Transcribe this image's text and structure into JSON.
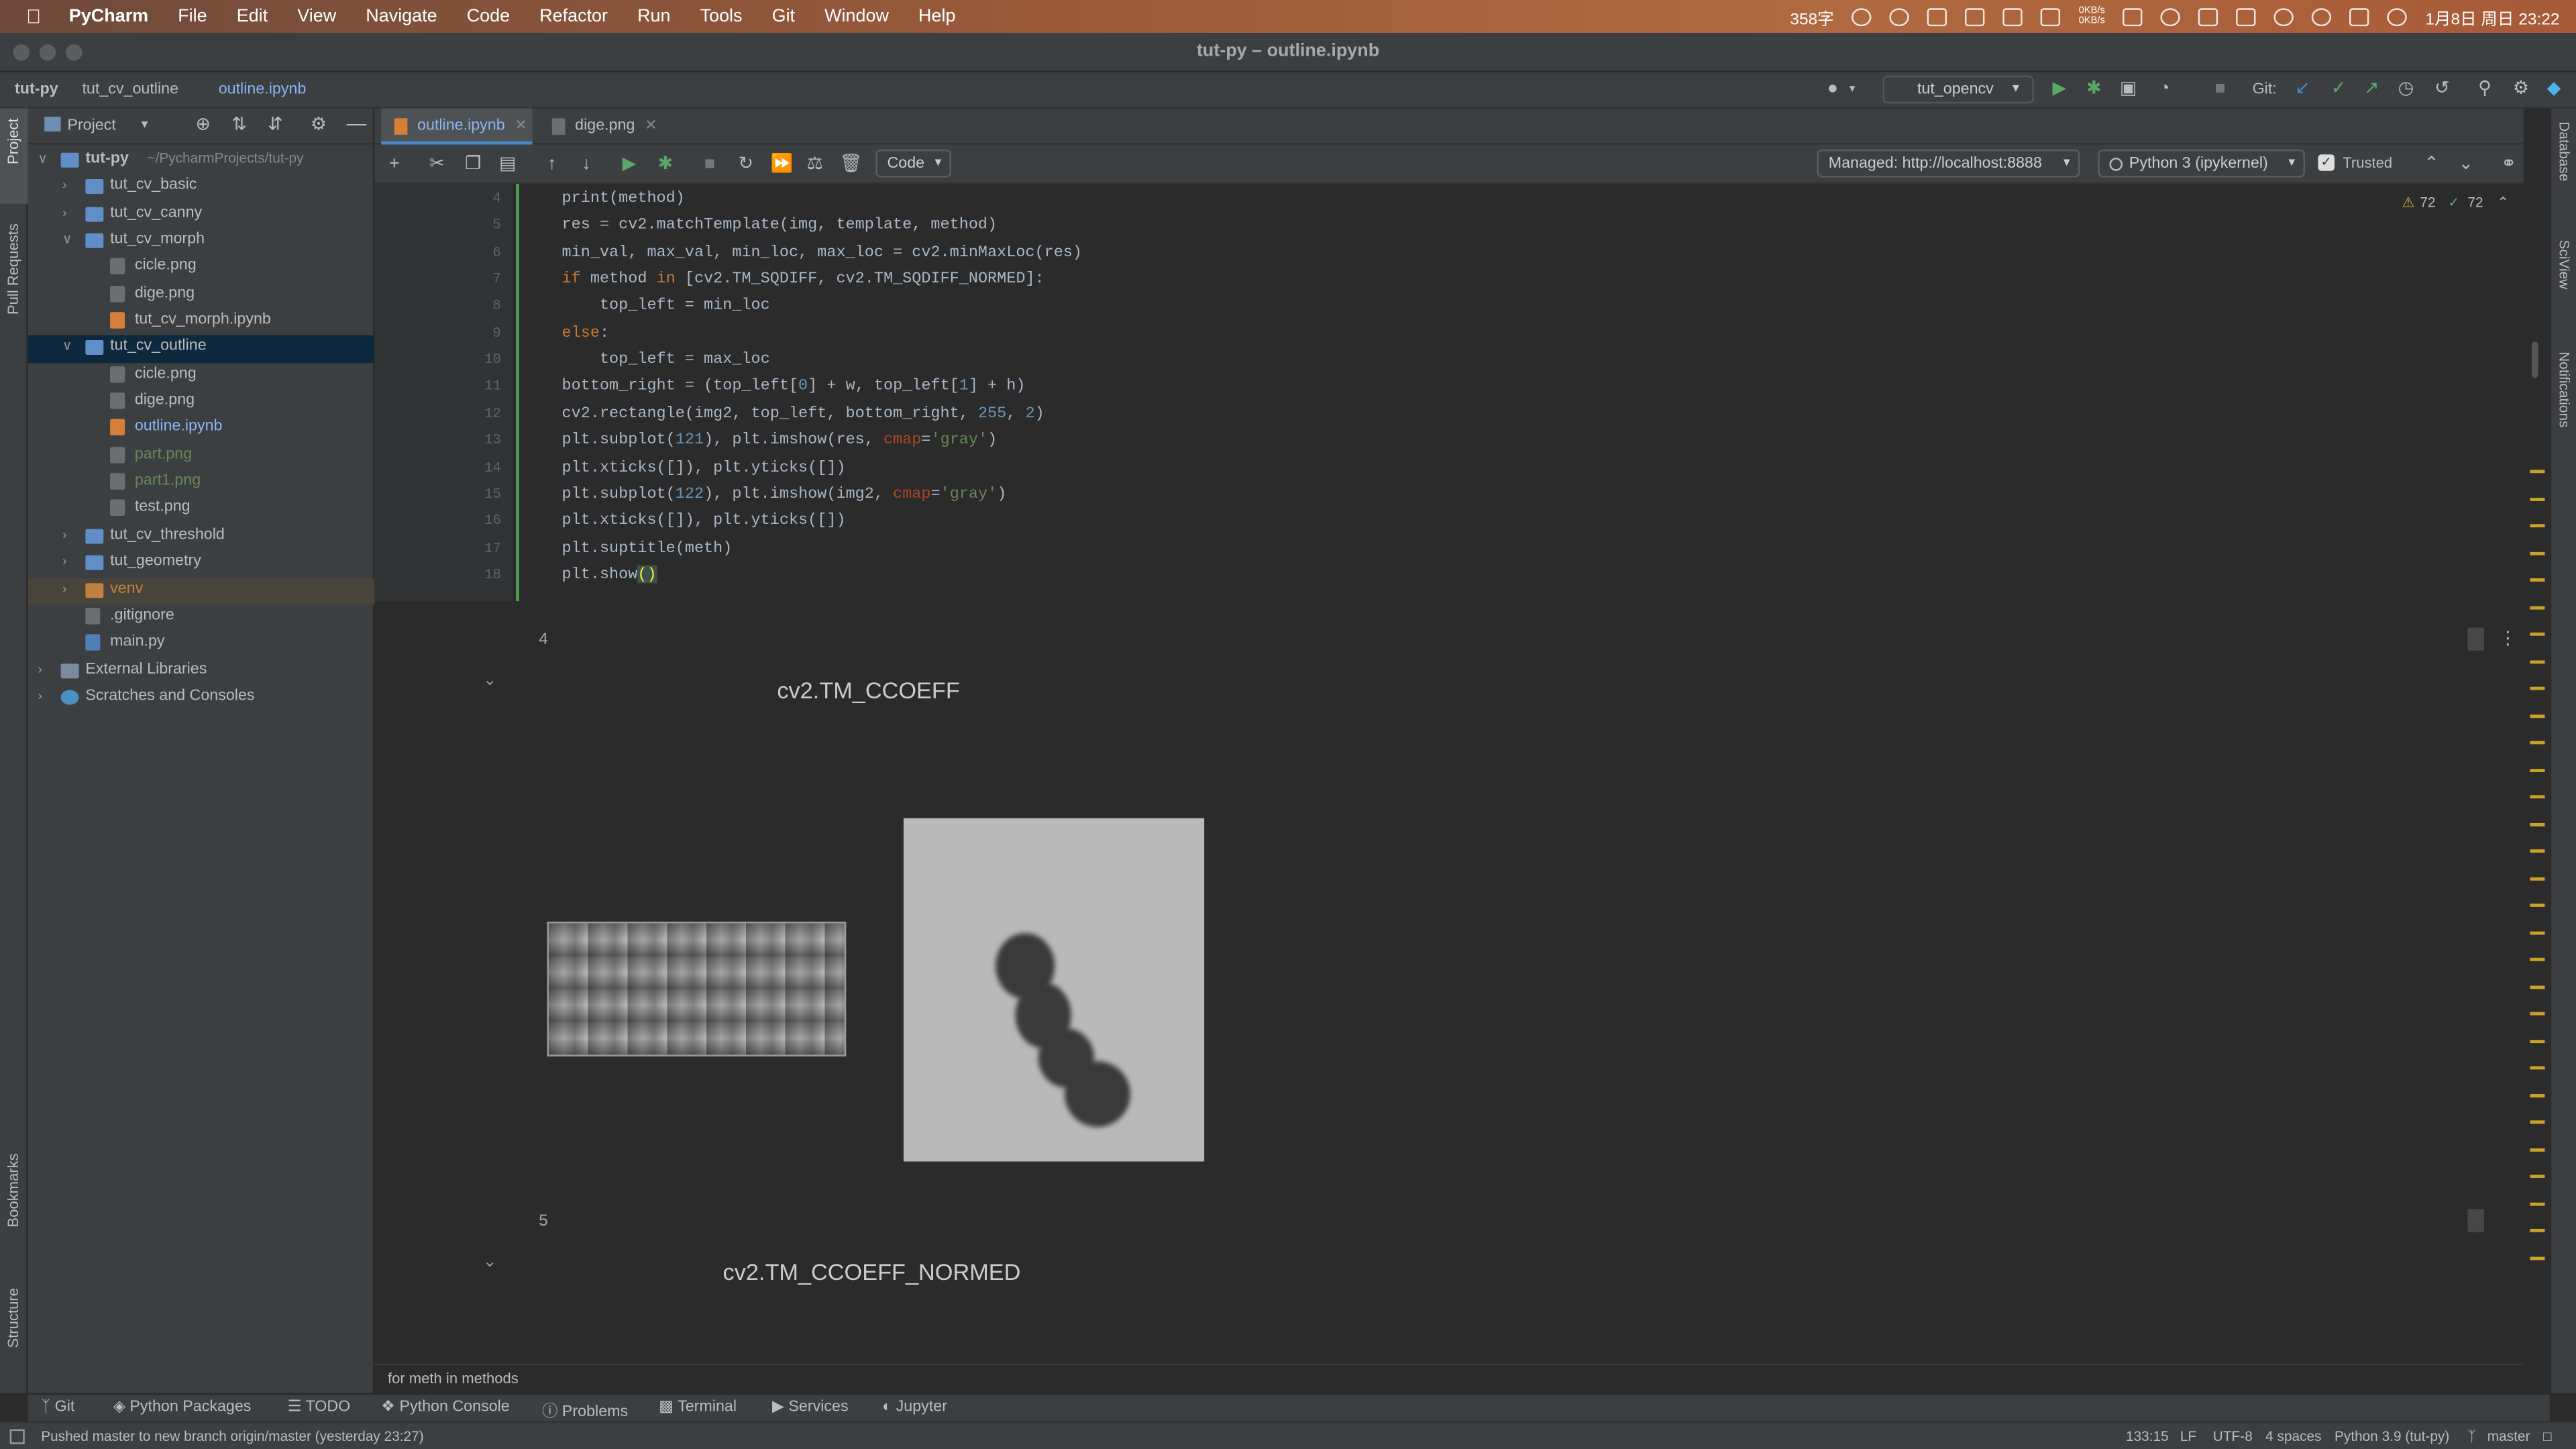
{
  "menubar": {
    "app_name": "PyCharm",
    "items": [
      "File",
      "Edit",
      "View",
      "Navigate",
      "Code",
      "Refactor",
      "Run",
      "Tools",
      "Git",
      "Window",
      "Help"
    ],
    "word_count": "358字",
    "net_speed_up": "0KB/s",
    "net_speed_down": "0KB/s",
    "datetime": "1月8日 周日 23:22"
  },
  "window": {
    "title": "tut-py – outline.ipynb"
  },
  "navbar": {
    "crumbs": [
      "tut-py",
      "tut_cv_outline",
      "outline.ipynb"
    ],
    "run_config": "tut_opencv",
    "git_label": "Git:"
  },
  "left_strip": {
    "project": "Project",
    "pull_requests": "Pull Requests",
    "bookmarks": "Bookmarks",
    "structure": "Structure"
  },
  "right_strip": {
    "database": "Database",
    "sciview": "SciView",
    "notifications": "Notifications"
  },
  "project_panel": {
    "title": "Project",
    "tree": [
      {
        "label": "tut-py",
        "hint": "~/PycharmProjects/tut-py",
        "kind": "folder",
        "indent": 0,
        "open": true
      },
      {
        "label": "tut_cv_basic",
        "kind": "folder",
        "indent": 1,
        "open": false
      },
      {
        "label": "tut_cv_canny",
        "kind": "folder",
        "indent": 1,
        "open": false
      },
      {
        "label": "tut_cv_morph",
        "kind": "folder",
        "indent": 1,
        "open": true
      },
      {
        "label": "cicle.png",
        "kind": "png",
        "indent": 2
      },
      {
        "label": "dige.png",
        "kind": "png",
        "indent": 2
      },
      {
        "label": "tut_cv_morph.ipynb",
        "kind": "nb",
        "indent": 2
      },
      {
        "label": "tut_cv_outline",
        "kind": "folder",
        "indent": 1,
        "open": true,
        "selected": true
      },
      {
        "label": "cicle.png",
        "kind": "png",
        "indent": 2
      },
      {
        "label": "dige.png",
        "kind": "png",
        "indent": 2
      },
      {
        "label": "outline.ipynb",
        "kind": "nb",
        "indent": 2,
        "color": "#8ab4f8"
      },
      {
        "label": "part.png",
        "kind": "png",
        "indent": 2,
        "color": "#6a8759"
      },
      {
        "label": "part1.png",
        "kind": "png",
        "indent": 2,
        "color": "#6a8759"
      },
      {
        "label": "test.png",
        "kind": "png",
        "indent": 2
      },
      {
        "label": "tut_cv_threshold",
        "kind": "folder",
        "indent": 1,
        "open": false
      },
      {
        "label": "tut_geometry",
        "kind": "folder",
        "indent": 1,
        "open": false
      },
      {
        "label": "venv",
        "kind": "folder-o",
        "indent": 1,
        "open": false,
        "venv": true,
        "color": "#c08041"
      },
      {
        "label": ".gitignore",
        "kind": "png",
        "indent": 1
      },
      {
        "label": "main.py",
        "kind": "py",
        "indent": 1
      },
      {
        "label": "External Libraries",
        "kind": "lib",
        "indent": 0,
        "open": false
      },
      {
        "label": "Scratches and Consoles",
        "kind": "sc",
        "indent": 0,
        "open": false
      }
    ]
  },
  "editor": {
    "tabs": [
      {
        "label": "outline.ipynb",
        "active": true
      },
      {
        "label": "dige.png",
        "active": false
      }
    ],
    "cell_type": "Code",
    "server": "Managed: http://localhost:8888",
    "kernel": "Python 3 (ipykernel)",
    "trusted_label": "Trusted",
    "warnings": "72",
    "ok": "72",
    "code_lines": [
      {
        "n": "4",
        "html": "print(method)"
      },
      {
        "n": "5",
        "html": "res = cv2.matchTemplate(img, template, method)"
      },
      {
        "n": "6",
        "html": "min_val, max_val, min_loc, max_loc = cv2.minMaxLoc(res)"
      },
      {
        "n": "7",
        "html": "<span class=\"kw\">if</span> method <span class=\"kw\">in</span> [cv2.TM_SQDIFF, cv2.TM_SQDIFF_NORMED]:"
      },
      {
        "n": "8",
        "html": "    top_left = min_loc"
      },
      {
        "n": "9",
        "html": "<span class=\"kw\">else</span>:"
      },
      {
        "n": "10",
        "html": "    top_left = max_loc"
      },
      {
        "n": "11",
        "html": "bottom_right = (top_left[<span class=\"num\">0</span>] + w, top_left[<span class=\"num\">1</span>] + h)"
      },
      {
        "n": "12",
        "html": "cv2.rectangle(img2, top_left, bottom_right, <span class=\"num\">255</span>, <span class=\"num\">2</span>)"
      },
      {
        "n": "13",
        "html": "plt.subplot(<span class=\"num\">121</span>), plt.imshow(res, <span class=\"par\">cmap</span>=<span class=\"str\">'gray'</span>)"
      },
      {
        "n": "14",
        "html": "plt.xticks([]), plt.yticks([])"
      },
      {
        "n": "15",
        "html": "plt.subplot(<span class=\"num\">122</span>), plt.imshow(img2, <span class=\"par\">cmap</span>=<span class=\"str\">'gray'</span>)"
      },
      {
        "n": "16",
        "html": "plt.xticks([]), plt.yticks([])"
      },
      {
        "n": "17",
        "html": "plt.suptitle(meth)"
      },
      {
        "n": "18",
        "html": "plt.show<span class=\"hl\">()</span>"
      }
    ],
    "output": {
      "out1_num": "4",
      "out1_title": "cv2.TM_CCOEFF",
      "out2_num": "5",
      "out2_title": "cv2.TM_CCOEFF_NORMED"
    },
    "sticky_context": "for meth in methods"
  },
  "tool_windows": [
    "Git",
    "Python Packages",
    "TODO",
    "Python Console",
    "Problems",
    "Terminal",
    "Services",
    "Jupyter"
  ],
  "status": {
    "message": "Pushed master to new branch origin/master (yesterday 23:27)",
    "position": "133:15",
    "line_sep": "LF",
    "encoding": "UTF-8",
    "indent": "4 spaces",
    "interpreter": "Python 3.9 (tut-py)",
    "branch": "master"
  }
}
